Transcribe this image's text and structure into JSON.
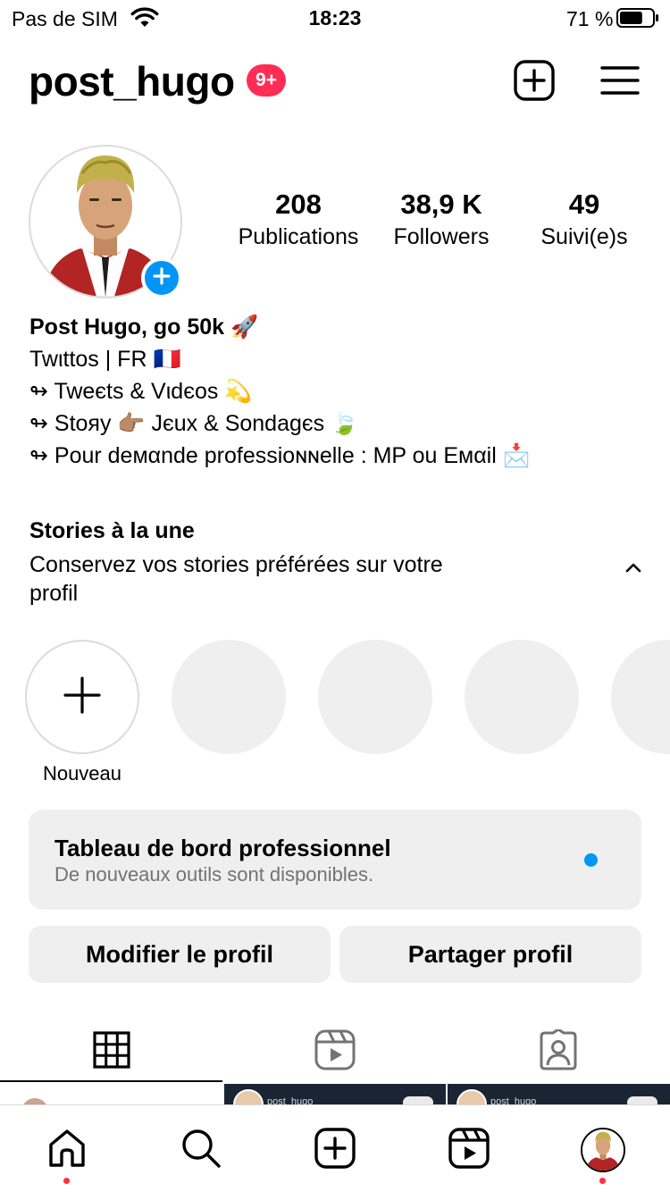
{
  "status_bar": {
    "carrier": "Pas de SIM",
    "time": "18:23",
    "battery_percent": "71 %",
    "battery_level": 0.71
  },
  "header": {
    "username": "post_hugo",
    "notification_badge": "9+",
    "create_icon": "plus-square-icon",
    "menu_icon": "hamburger-menu-icon"
  },
  "profile": {
    "avatar_icon": "cartoon-avatar",
    "add_story_icon": "plus-icon",
    "stats": [
      {
        "value": "208",
        "label": "Publications"
      },
      {
        "value": "38,9 K",
        "label": "Followers"
      },
      {
        "value": "49",
        "label": "Suivi(e)s"
      }
    ]
  },
  "bio": {
    "name": "Post Hugo, go 50k 🚀",
    "lines": [
      "Twιttos | FR 🇫🇷",
      "↬ Tweєts & Vιdєos 💫",
      "↬ Stoяy 👉🏽 Jєux & Sondagєs 🍃",
      "↬ Pour deмαnde professioɴɴelle : MP ou Eмαil 📩"
    ]
  },
  "stories": {
    "title": "Stories à la une",
    "subtitle": "Conservez vos stories préférées sur votre profil",
    "new_label": "Nouveau",
    "chevron_icon": "chevron-up-icon"
  },
  "dashboard": {
    "title": "Tableau de bord professionnel",
    "subtitle": "De nouveaux outils sont disponibles."
  },
  "actions": {
    "edit_profile": "Modifier le profil",
    "share_profile": "Partager profil"
  },
  "tabs": [
    {
      "icon": "grid-icon",
      "active": true
    },
    {
      "icon": "reels-icon",
      "active": false
    },
    {
      "icon": "tagged-icon",
      "active": false
    }
  ],
  "grid_peek": {
    "post_username": "post_hugo"
  },
  "bottom_nav": [
    {
      "icon": "home-icon",
      "dot": true
    },
    {
      "icon": "search-icon",
      "dot": false
    },
    {
      "icon": "create-icon",
      "dot": false
    },
    {
      "icon": "reels-icon",
      "dot": false
    },
    {
      "icon": "profile-avatar-icon",
      "dot": true
    }
  ],
  "colors": {
    "accent_blue": "#0095f6",
    "badge_red": "#ff2d55",
    "notification_dot": "#ff3040",
    "surface_gray": "#efefef"
  }
}
